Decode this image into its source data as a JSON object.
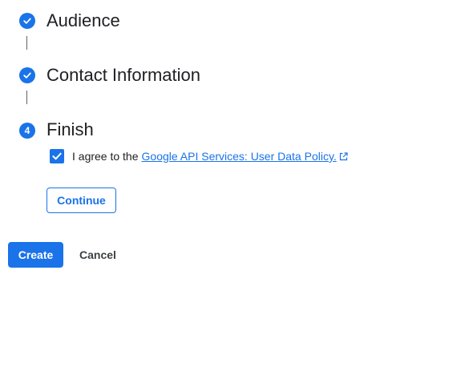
{
  "stepper": {
    "steps": [
      {
        "title": "Audience",
        "state": "completed",
        "icon": "check-icon"
      },
      {
        "title": "Contact Information",
        "state": "completed",
        "icon": "check-icon"
      },
      {
        "title": "Finish",
        "state": "active",
        "number": "4"
      }
    ]
  },
  "finish": {
    "agreement": {
      "checked": true,
      "text": "I agree to the",
      "link_text": "Google API Services: User Data Policy.",
      "link_icon": "open-in-new-icon"
    },
    "continue_label": "Continue"
  },
  "actions": {
    "create_label": "Create",
    "cancel_label": "Cancel"
  },
  "colors": {
    "accent": "#1a73e8",
    "text": "#202124",
    "connector": "#5f6368"
  }
}
